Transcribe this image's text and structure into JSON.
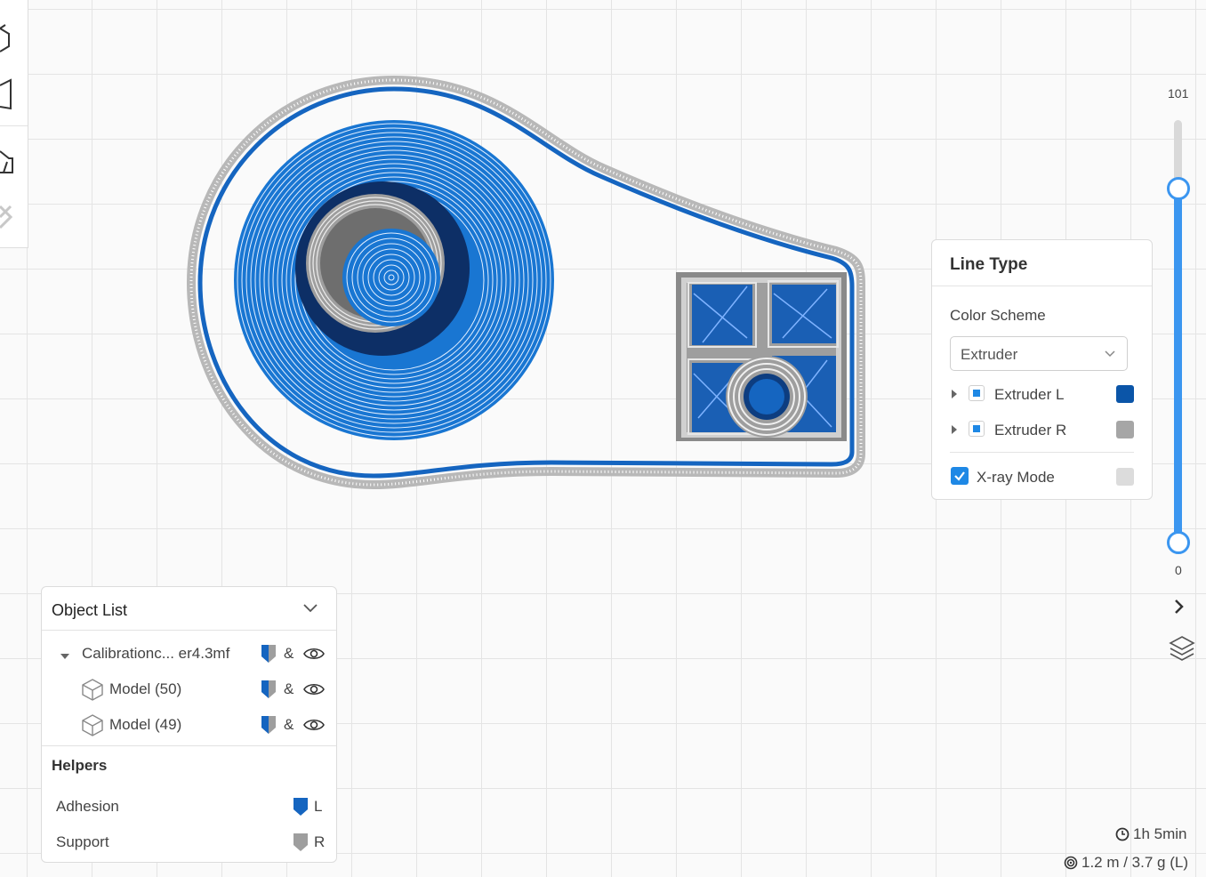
{
  "colors": {
    "extruder_l": "#0b55a8",
    "extruder_r": "#a6a6a6",
    "xray": "#dcdcdc",
    "accent": "#1e88e5",
    "blue_path": "#1565c0",
    "gray_path": "#9e9e9e"
  },
  "toolbar": {
    "icons": [
      "cube-plus-icon",
      "panel-icon",
      "support-icon",
      "cross-icon"
    ]
  },
  "line_type_panel": {
    "title": "Line Type",
    "color_scheme_label": "Color Scheme",
    "color_scheme_value": "Extruder",
    "extruders": [
      {
        "label": "Extruder L",
        "color": "#0b55a8"
      },
      {
        "label": "Extruder R",
        "color": "#a6a6a6"
      }
    ],
    "xray_label": "X-ray Mode",
    "xray_checked": true
  },
  "layer_slider": {
    "max_label": "101",
    "min_label": "0"
  },
  "object_list": {
    "title": "Object List",
    "project": {
      "name": "Calibrationc... er4.3mf",
      "ext": "&"
    },
    "models": [
      {
        "name": "Model (50)",
        "ext": "&"
      },
      {
        "name": "Model (49)",
        "ext": "&"
      }
    ],
    "helpers_title": "Helpers",
    "helpers": [
      {
        "name": "Adhesion",
        "ext": "L"
      },
      {
        "name": "Support",
        "ext": "R"
      }
    ]
  },
  "stats": {
    "time": "1h 5min",
    "material": "1.2 m / 3.7 g (L)"
  }
}
